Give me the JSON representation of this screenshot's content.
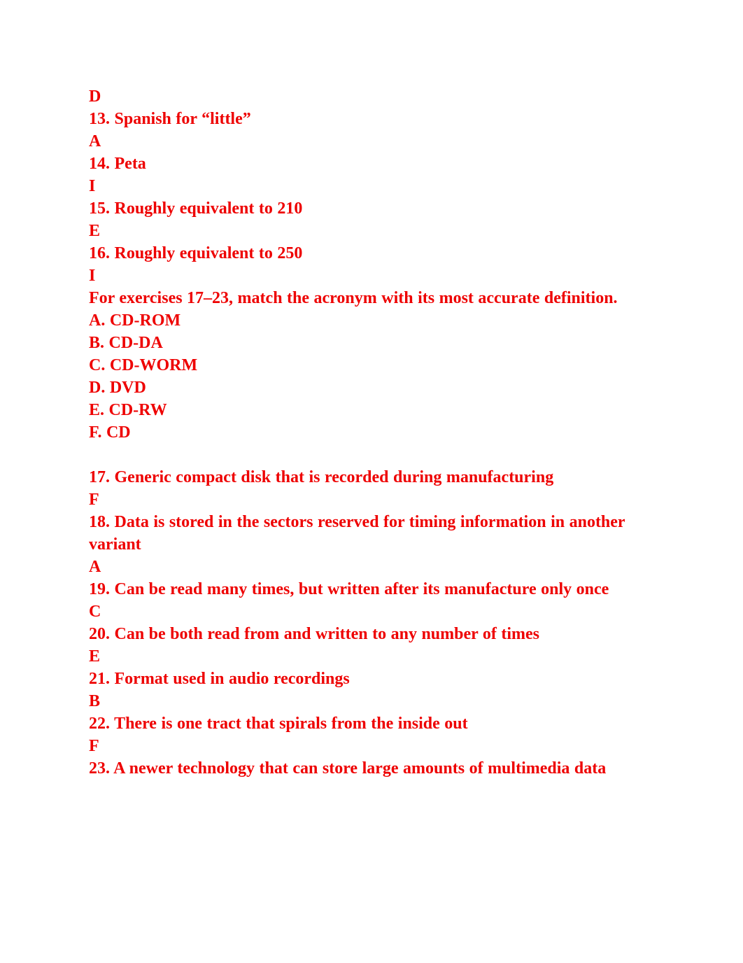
{
  "document": {
    "text_color": "#ee0000",
    "background_color": "#ffffff",
    "lines": [
      {
        "id": "l01",
        "kind": "answer",
        "text": "D"
      },
      {
        "id": "l02",
        "kind": "question",
        "text": "13. Spanish for “little”"
      },
      {
        "id": "l03",
        "kind": "answer",
        "text": "A"
      },
      {
        "id": "l04",
        "kind": "question",
        "text": "14. Peta"
      },
      {
        "id": "l05",
        "kind": "answer",
        "text": "I"
      },
      {
        "id": "l06",
        "kind": "question",
        "text": "15. Roughly equivalent to 210"
      },
      {
        "id": "l07",
        "kind": "answer",
        "text": "E"
      },
      {
        "id": "l08",
        "kind": "question",
        "text": "16. Roughly equivalent to 250"
      },
      {
        "id": "l09",
        "kind": "answer",
        "text": "I"
      },
      {
        "id": "l10",
        "kind": "instruction",
        "text": "For exercises 17–23, match the acronym with its most accurate definition."
      },
      {
        "id": "l11",
        "kind": "option",
        "text": "A. CD-ROM"
      },
      {
        "id": "l12",
        "kind": "option",
        "text": "B. CD-DA"
      },
      {
        "id": "l13",
        "kind": "option",
        "text": "C. CD-WORM"
      },
      {
        "id": "l14",
        "kind": "option",
        "text": "D. DVD"
      },
      {
        "id": "l15",
        "kind": "option",
        "text": "E. CD-RW"
      },
      {
        "id": "l16",
        "kind": "option",
        "text": "F. CD"
      },
      {
        "id": "l17",
        "kind": "blank",
        "text": ""
      },
      {
        "id": "l18",
        "kind": "question",
        "text": "17. Generic compact disk that is recorded during manufacturing"
      },
      {
        "id": "l19",
        "kind": "answer",
        "text": "F"
      },
      {
        "id": "l20",
        "kind": "question",
        "text": "18. Data is stored in the sectors reserved for timing information in another\nvariant"
      },
      {
        "id": "l21",
        "kind": "answer",
        "text": "A"
      },
      {
        "id": "l22",
        "kind": "question",
        "text": "19. Can be read many times, but written after its manufacture only once"
      },
      {
        "id": "l23",
        "kind": "answer",
        "text": "C"
      },
      {
        "id": "l24",
        "kind": "question",
        "text": "20. Can be both read from and written to any number of times"
      },
      {
        "id": "l25",
        "kind": "answer",
        "text": "E"
      },
      {
        "id": "l26",
        "kind": "question",
        "text": "21. Format used in audio recordings"
      },
      {
        "id": "l27",
        "kind": "answer",
        "text": "B"
      },
      {
        "id": "l28",
        "kind": "question",
        "text": "22. There is one tract that spirals from the inside out"
      },
      {
        "id": "l29",
        "kind": "answer",
        "text": "F"
      },
      {
        "id": "l30",
        "kind": "question",
        "text": "23. A newer technology that can store large amounts of multimedia data"
      }
    ]
  }
}
